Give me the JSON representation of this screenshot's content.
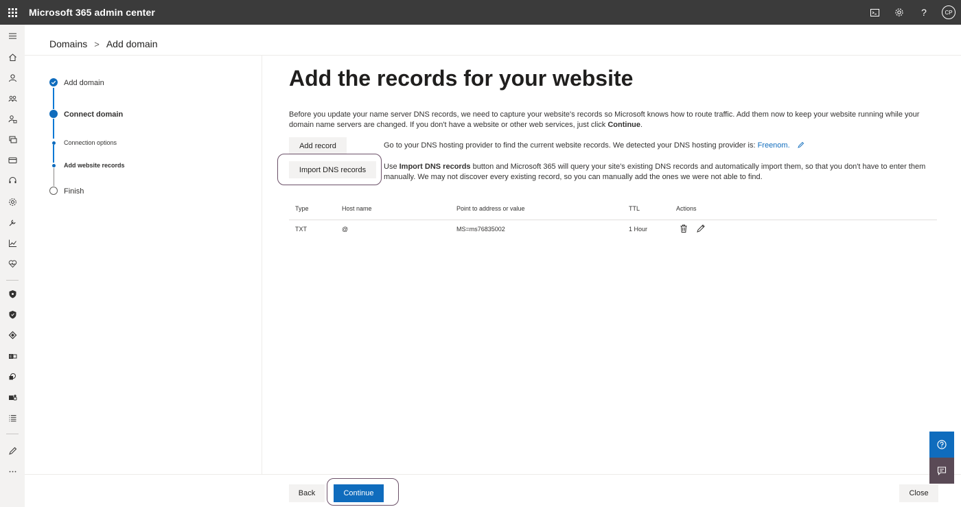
{
  "header": {
    "app_title": "Microsoft 365 admin center",
    "avatar_initials": "CP",
    "help_glyph": "?"
  },
  "breadcrumb": {
    "parent": "Domains",
    "separator": ">",
    "current": "Add domain"
  },
  "steps": [
    {
      "label": "Add domain",
      "state": "complete"
    },
    {
      "label": "Connect domain",
      "state": "current"
    },
    {
      "label": "Connection options",
      "state": "substep-complete"
    },
    {
      "label": "Add website records",
      "state": "substep-current"
    },
    {
      "label": "Finish",
      "state": "pending"
    }
  ],
  "main": {
    "title": "Add the records for your website",
    "intro_part1": "Before you update your name server DNS records, we need to capture your website's records so Microsoft knows how to route traffic. Add them now to keep your website running while your domain name servers are changed. If you don't have a website or other web services, just click ",
    "intro_bold": "Continue",
    "intro_end": ".",
    "add_record_label": "Add record",
    "add_record_desc": "Go to your DNS hosting provider to find the current website records. We detected your DNS hosting provider is: ",
    "dns_provider": "Freenom.",
    "import_label": "Import DNS records",
    "import_desc_pre": "Use ",
    "import_desc_bold": "Import DNS records",
    "import_desc_post": " button and Microsoft 365 will query your site's existing DNS records and automatically import them, so that you don't have to enter them manually. We may not discover every existing record, so you can manually add the ones we were not able to find."
  },
  "table": {
    "columns": [
      "Type",
      "Host name",
      "Point to address or value",
      "TTL",
      "Actions"
    ],
    "rows": [
      {
        "type": "TXT",
        "host": "@",
        "value": "MS=ms76835002",
        "ttl": "1 Hour"
      }
    ]
  },
  "footer": {
    "back_label": "Back",
    "continue_label": "Continue",
    "close_label": "Close"
  },
  "colors": {
    "accent": "#0f6cbd",
    "header_bg": "#3b3b3b",
    "highlight_ring": "#6b5068"
  },
  "rail_icons": [
    "hamburger-icon",
    "home-icon",
    "user-icon",
    "groups-icon",
    "roles-icon",
    "resources-icon",
    "billing-icon",
    "support-icon",
    "settings-icon",
    "setup-icon",
    "reports-icon",
    "health-icon",
    "security-icon",
    "compliance-icon",
    "endpoint-icon",
    "exchange-icon",
    "sharepoint-icon",
    "teams-icon",
    "all-admin-centers-icon",
    "customize-icon",
    "more-icon"
  ]
}
